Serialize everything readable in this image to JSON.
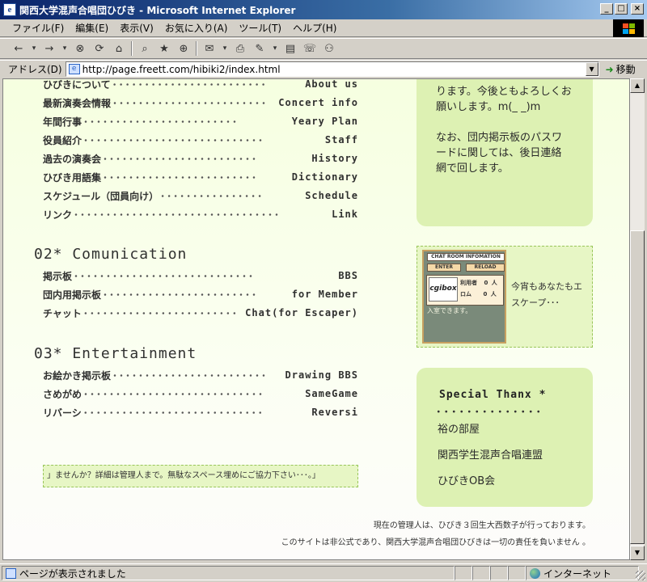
{
  "window": {
    "title": "関西大学混声合唱団ひびき - Microsoft Internet Explorer",
    "min_label": "_",
    "max_label": "□",
    "close_label": "×"
  },
  "menu": [
    "ファイル(F)",
    "編集(E)",
    "表示(V)",
    "お気に入り(A)",
    "ツール(T)",
    "ヘルプ(H)"
  ],
  "toolbar_icons": [
    "←",
    "▾",
    "→",
    "▾",
    "⊗",
    "⟳",
    "⌂",
    "⌕",
    "★",
    "⊕",
    "✉",
    "▾",
    "⎙",
    "✎",
    "▾",
    "▤",
    "☏",
    "⚇"
  ],
  "address": {
    "label": "アドレス(D)",
    "url": "http://page.freett.com/hibiki2/index.html",
    "go_label": "移動"
  },
  "nav_top": [
    {
      "jp": "ひびきについて",
      "en": "About us"
    },
    {
      "jp": "最新演奏会情報",
      "en": "Concert info"
    },
    {
      "jp": "年間行事",
      "en": "Yeary Plan"
    },
    {
      "jp": "役員紹介",
      "en": "Staff"
    },
    {
      "jp": "過去の演奏会",
      "en": "History"
    },
    {
      "jp": "ひびき用語集",
      "en": "Dictionary"
    },
    {
      "jp": "スケジュール（団員向け）",
      "en": "Schedule"
    },
    {
      "jp": "リンク",
      "en": "Link"
    }
  ],
  "section2": {
    "title": "02* Comunication",
    "items": [
      {
        "jp": "掲示板",
        "en": "BBS"
      },
      {
        "jp": "団内用掲示板",
        "en": "for Member"
      },
      {
        "jp": "チャット",
        "en": "Chat(for Escaper)"
      }
    ]
  },
  "section3": {
    "title": "03* Entertainment",
    "items": [
      {
        "jp": "お絵かき掲示板",
        "en": "Drawing BBS"
      },
      {
        "jp": "さめがめ",
        "en": "SameGame"
      },
      {
        "jp": "リバーシ",
        "en": "Reversi"
      }
    ]
  },
  "notice": {
    "line1": "ります。今後ともよろしくお",
    "line2": "願いします。m(_ _)m",
    "line3": "なお、団内掲示板のパスワ",
    "line4": "ードに関しては、後日連絡",
    "line5": "網で回します。"
  },
  "chat": {
    "title": "CHAT ROOM INFOMATION",
    "enter": "ENTER",
    "reload": "RELOAD",
    "logo": "cgibox",
    "users_label": "利用者",
    "users_count": "0",
    "users_unit": "人",
    "rom_label": "ロム",
    "rom_count": "0",
    "rom_unit": "人",
    "status": "入室できます。",
    "caption": "今宵もあなたもエスケープ･･･"
  },
  "thanks": {
    "title": "Special Thanx *",
    "dots": "･･････････････",
    "links": [
      "裕の部屋",
      "関西学生混声合唱連盟",
      "ひびきOB会"
    ]
  },
  "banner": "」ませんか？詳細は管理人まで。無駄なスペース埋めにご協力下さい･･･。」",
  "footer": {
    "line1": "現在の管理人は、ひびき３回生大西数子が行っております。",
    "line2": "このサイトは非公式であり、関西大学混声合唱団ひびきは一切の責任を負いません 。"
  },
  "status": {
    "text": "ページが表示されました",
    "zone": "インターネット"
  },
  "colors": {
    "title_start": "#0a246a",
    "side_box": "#ddf1b3",
    "dashed_border": "#99c65a"
  }
}
